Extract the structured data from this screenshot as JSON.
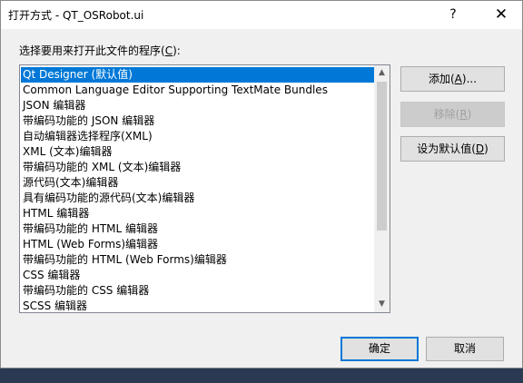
{
  "window": {
    "title": "打开方式 - QT_OSRobot.ui",
    "help_glyph": "?",
    "close_glyph": "✕"
  },
  "prompt": {
    "text_before": "选择要用来打开此文件的程序(",
    "hotkey": "C",
    "text_after": "):"
  },
  "programs": {
    "selected_index": 0,
    "items": [
      "Qt Designer (默认值)",
      "Common Language Editor Supporting TextMate Bundles",
      "JSON 编辑器",
      "带编码功能的 JSON 编辑器",
      "自动编辑器选择程序(XML)",
      "XML (文本)编辑器",
      "带编码功能的 XML (文本)编辑器",
      "源代码(文本)编辑器",
      "具有编码功能的源代码(文本)编辑器",
      "HTML 编辑器",
      "带编码功能的 HTML 编辑器",
      "HTML (Web Forms)编辑器",
      "带编码功能的 HTML (Web Forms)编辑器",
      "CSS 编辑器",
      "带编码功能的 CSS 编辑器",
      "SCSS 编辑器"
    ]
  },
  "buttons": {
    "add": {
      "before": "添加(",
      "hotkey": "A",
      "after": ")..."
    },
    "remove": {
      "before": "移除(",
      "hotkey": "R",
      "after": ")",
      "enabled": false
    },
    "set_default": {
      "before": "设为默认值(",
      "hotkey": "D",
      "after": ")"
    },
    "ok": "确定",
    "cancel": "取消"
  },
  "colors": {
    "selection": "#0078d7",
    "dialog_bg": "#f0f0f0"
  }
}
